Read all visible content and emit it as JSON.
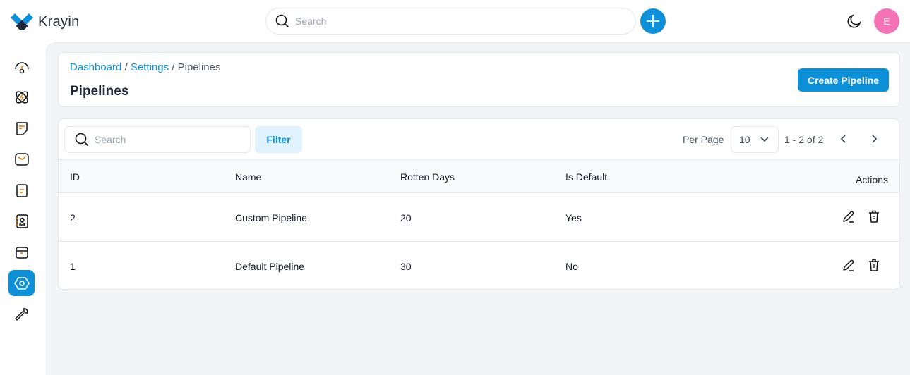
{
  "app": {
    "name": "Krayin",
    "search_placeholder": "Search",
    "user_initial": "E",
    "accent": "#0e90d9"
  },
  "sidebar": {
    "items": [
      {
        "icon": "dashboard-icon"
      },
      {
        "icon": "leads-icon"
      },
      {
        "icon": "quotes-icon"
      },
      {
        "icon": "mail-icon"
      },
      {
        "icon": "activities-icon"
      },
      {
        "icon": "contacts-icon"
      },
      {
        "icon": "products-icon"
      },
      {
        "icon": "settings-icon",
        "active": true
      },
      {
        "icon": "configuration-icon"
      }
    ]
  },
  "breadcrumb": {
    "items": [
      "Dashboard",
      "Settings"
    ],
    "current": "Pipelines",
    "sep": "/"
  },
  "page": {
    "title": "Pipelines",
    "create_label": "Create Pipeline"
  },
  "toolbar": {
    "search_placeholder": "Search",
    "filter_label": "Filter",
    "per_page_label": "Per Page",
    "per_page_value": "10",
    "range": "1 - 2 of 2"
  },
  "table": {
    "columns": [
      "ID",
      "Name",
      "Rotten Days",
      "Is Default",
      "Actions"
    ],
    "rows": [
      [
        "2",
        "Custom Pipeline",
        "20",
        "Yes"
      ],
      [
        "1",
        "Default Pipeline",
        "30",
        "No"
      ]
    ]
  }
}
